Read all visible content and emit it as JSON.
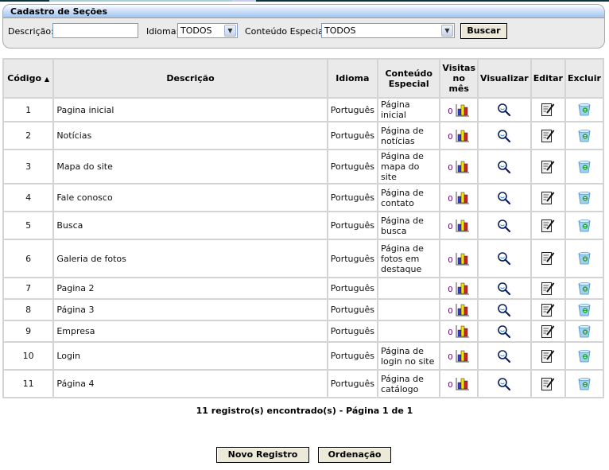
{
  "panel": {
    "title": "Cadastro de Seções",
    "filters": {
      "descricao_label": "Descrição:",
      "descricao_value": "",
      "idioma_label": "Idioma:",
      "idioma_value": "TODOS",
      "conteudo_label": "Conteúdo Especial:",
      "conteudo_value": "TODOS",
      "buscar_label": "Buscar"
    }
  },
  "table": {
    "headers": {
      "codigo": "Código",
      "descricao": "Descrição",
      "idioma": "Idioma",
      "conteudo_1": "Conteúdo",
      "conteudo_2": "Especial",
      "visitas_1": "Visitas",
      "visitas_2": "no",
      "visitas_3": "mês",
      "visualizar": "Visualizar",
      "editar": "Editar",
      "excluir": "Excluir"
    },
    "sort": {
      "column": "Código",
      "direction": "ascending"
    },
    "icons": {
      "visits": "bar-chart-icon",
      "view": "magnifier-icon",
      "edit": "edit-document-icon",
      "delete": "recycle-bin-icon"
    },
    "rows": [
      {
        "codigo": "1",
        "descricao": "Pagina inicial",
        "idioma": "Português",
        "conteudo": "Página inicial",
        "visitas": "0"
      },
      {
        "codigo": "2",
        "descricao": "Notícias",
        "idioma": "Português",
        "conteudo": "Página de notícias",
        "visitas": "0"
      },
      {
        "codigo": "3",
        "descricao": "Mapa do site",
        "idioma": "Português",
        "conteudo": "Página de mapa do site",
        "visitas": "0"
      },
      {
        "codigo": "4",
        "descricao": "Fale conosco",
        "idioma": "Português",
        "conteudo": "Página de contato",
        "visitas": "0"
      },
      {
        "codigo": "5",
        "descricao": "Busca",
        "idioma": "Português",
        "conteudo": "Página de busca",
        "visitas": "0"
      },
      {
        "codigo": "6",
        "descricao": "Galeria de fotos",
        "idioma": "Português",
        "conteudo": "Página de fotos em destaque",
        "visitas": "0"
      },
      {
        "codigo": "7",
        "descricao": "Pagina 2",
        "idioma": "Português",
        "conteudo": "",
        "visitas": "0"
      },
      {
        "codigo": "8",
        "descricao": "Página 3",
        "idioma": "Português",
        "conteudo": "",
        "visitas": "0"
      },
      {
        "codigo": "9",
        "descricao": "Empresa",
        "idioma": "Português",
        "conteudo": "",
        "visitas": "0"
      },
      {
        "codigo": "10",
        "descricao": "Login",
        "idioma": "Português",
        "conteudo": "Página de login no site",
        "visitas": "0"
      },
      {
        "codigo": "11",
        "descricao": "Página 4",
        "idioma": "Português",
        "conteudo": "Página de catálogo",
        "visitas": "0"
      }
    ]
  },
  "footer": {
    "summary": "11 registro(s) encontrado(s) - Página 1 de 1",
    "novo_registro_label": "Novo Registro",
    "ordenacao_label": "Ordenação"
  },
  "colors": {
    "header_gradient_end": "#9fc4f0",
    "panel_bg": "#ebebeb",
    "button_bg": "#ece9d8",
    "grid_border": "#d4d4d4",
    "table_header_bg": "#eaeaea"
  }
}
